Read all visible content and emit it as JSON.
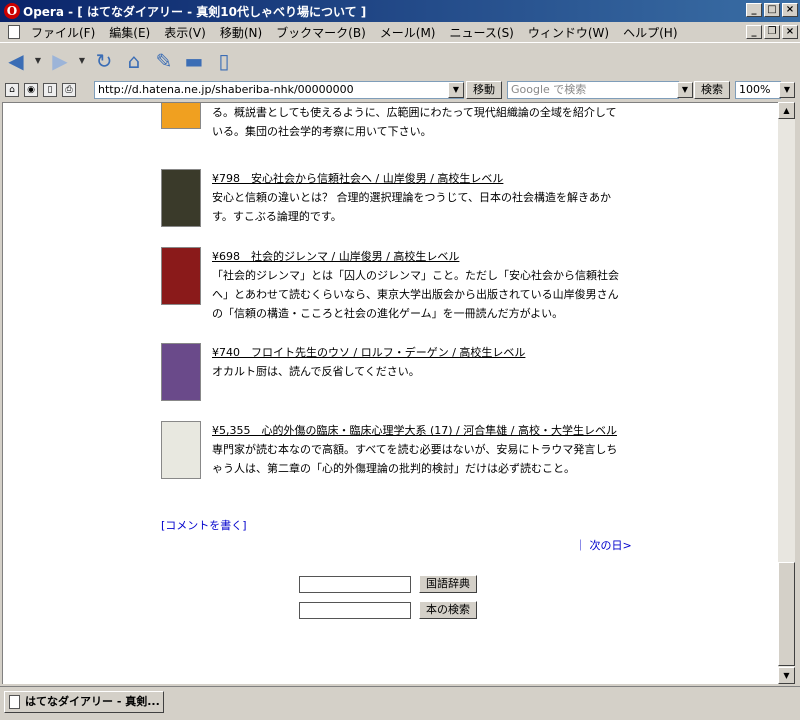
{
  "window": {
    "title": "Opera - [ はてなダイアリー - 真剣10代しゃべり場について ]"
  },
  "menu": [
    "ファイル(F)",
    "編集(E)",
    "表示(V)",
    "移動(N)",
    "ブックマーク(B)",
    "メール(M)",
    "ニュース(S)",
    "ウィンドウ(W)",
    "ヘルプ(H)"
  ],
  "address": {
    "url": "http://d.hatena.ne.jp/shaberiba-nhk/00000000",
    "go_label": "移動",
    "search_placeholder": "Google で検索",
    "search_label": "検索",
    "zoom": "100%"
  },
  "books": [
    {
      "title": "",
      "desc": "る。概説書としても使えるように、広範囲にわたって現代組織論の全域を紹介している。集団の社会学的考察に用いて下さい。",
      "cover": "#f0a020"
    },
    {
      "title": "¥798　安心社会から信頼社会へ / 山岸俊男 / 高校生レベル",
      "desc": "安心と信頼の違いとは？ 合理的選択理論をつうじて、日本の社会構造を解きあかす。すこぶる論理的です。",
      "cover": "#3a3a2a"
    },
    {
      "title": "¥698　社会的ジレンマ / 山岸俊男 / 高校生レベル",
      "desc": "「社会的ジレンマ」とは「囚人のジレンマ」こと。ただし「安心社会から信頼社会へ」とあわせて読むくらいなら、東京大学出版会から出版されている山岸俊男さんの「信頼の構造・こころと社会の進化ゲーム」を一冊読んだ方がよい。",
      "cover": "#8a1a1a"
    },
    {
      "title": "¥740　フロイト先生のウソ / ロルフ・デーゲン / 高校生レベル",
      "desc": "オカルト厨は、読んで反省してください。",
      "cover": "#6a4a8a"
    },
    {
      "title": "¥5,355　心的外傷の臨床・臨床心理学大系 (17) / 河合隼雄 / 高校・大学生レベル",
      "desc": "専門家が読む本なので高額。すべてを読む必要はないが、安易にトラウマ発言しちゃう人は、第二章の「心的外傷理論の批判的検討」だけは必ず読むこと。",
      "cover": "#e8e8e0"
    }
  ],
  "links": {
    "comment": "[コメントを書く]",
    "next_day": "｜ 次の日>"
  },
  "forms": {
    "dict_label": "国語辞典",
    "book_search_label": "本の検索"
  },
  "tab": {
    "label": "はてなダイアリー - 真剣..."
  }
}
